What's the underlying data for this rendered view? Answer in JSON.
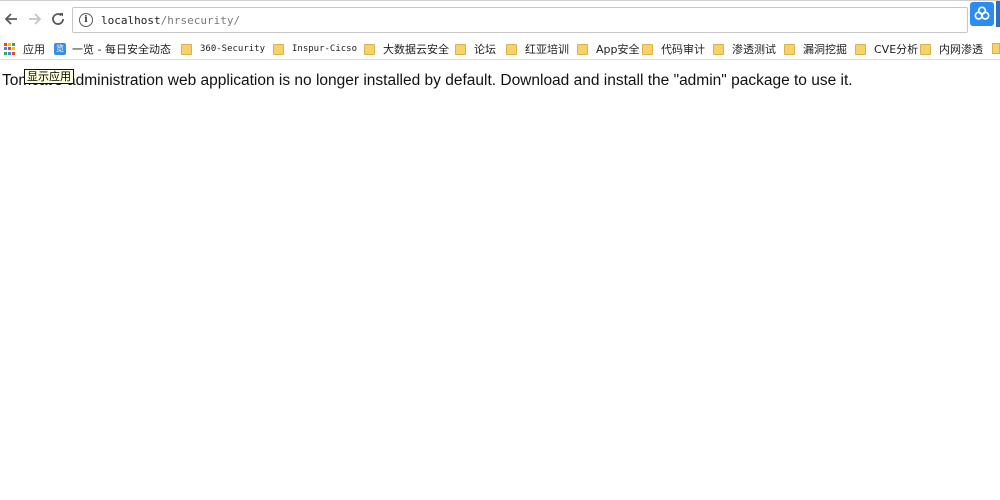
{
  "browser": {
    "address_bar": {
      "host": "localhost",
      "path": "/hrsecurity/",
      "info_glyph": "i"
    },
    "icons": {
      "back": "back-arrow-icon",
      "forward": "forward-arrow-icon",
      "reload": "reload-icon",
      "extension": "cloud-extension-icon"
    }
  },
  "bookmarks": {
    "apps_label": "应用",
    "items": [
      {
        "label": "一览 - 每日安全动态",
        "icon": "site-icon",
        "glyph": "览"
      },
      {
        "label": "360-Security",
        "icon": "folder-icon"
      },
      {
        "label": "Inspur-Cicso",
        "icon": "folder-icon"
      },
      {
        "label": "大数据云安全",
        "icon": "folder-icon"
      },
      {
        "label": "论坛",
        "icon": "folder-icon"
      },
      {
        "label": "红亚培训",
        "icon": "folder-icon"
      },
      {
        "label": "App安全",
        "icon": "folder-icon"
      },
      {
        "label": "代码审计",
        "icon": "folder-icon"
      },
      {
        "label": "渗透测试",
        "icon": "folder-icon"
      },
      {
        "label": "漏洞挖掘",
        "icon": "folder-icon"
      },
      {
        "label": "CVE分析",
        "icon": "folder-icon"
      },
      {
        "label": "内网渗透",
        "icon": "folder-icon"
      }
    ],
    "apps_grid_colors": [
      "#ea4335",
      "#fbbc05",
      "#34a853",
      "#4285f4",
      "#ea4335",
      "#fbbc05",
      "#34a853",
      "#4285f4",
      "#ea4335"
    ]
  },
  "tooltip": {
    "text": "显示应用"
  },
  "page": {
    "message": "Tomcat's administration web application is no longer installed by default. Download and install the \"admin\" package to use it."
  }
}
